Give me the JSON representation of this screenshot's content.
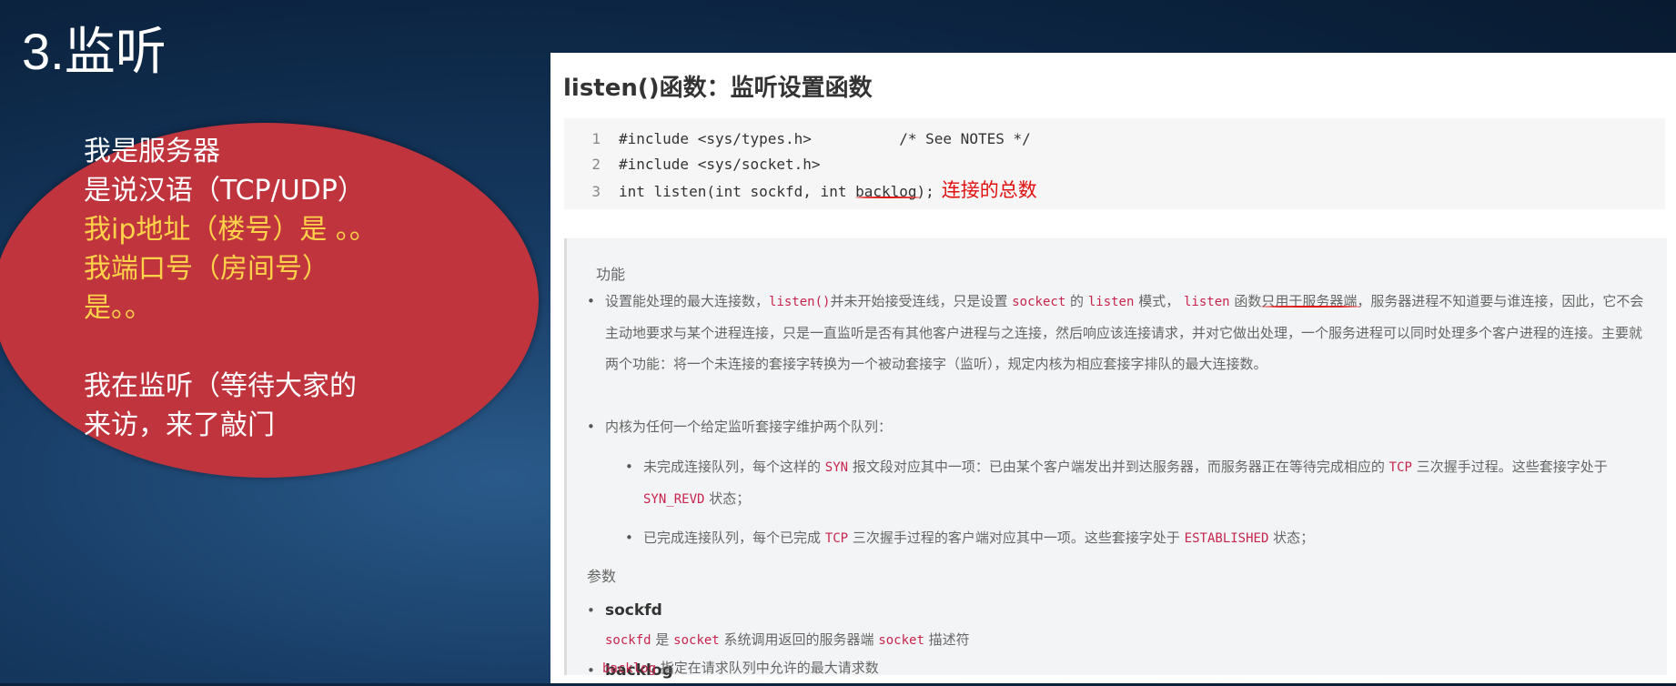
{
  "slide": {
    "title": "3.监听",
    "bubble": [
      "我是服务器",
      "是说汉语（TCP/UDP）",
      "我ip地址（楼号）是 。。",
      "我端口号（房间号）",
      "是。。",
      "",
      "我在监听（等待大家的",
      "来访，来了敲门"
    ]
  },
  "doc": {
    "title": "listen()函数：监听设置函数",
    "code": [
      {
        "n": "1",
        "text": "#include <sys/types.h>          /* See NOTES */"
      },
      {
        "n": "2",
        "text": "#include <sys/socket.h>"
      },
      {
        "n": "3",
        "pre": "int listen(int sockfd, int ",
        "u": "backlog",
        "post": ");"
      }
    ],
    "annotation": "连接的总数",
    "function_heading": "功能",
    "p1": [
      "设置能处理的最大连接数，",
      "listen()",
      "并未开始接受连线，只是设置",
      "sockect",
      "的",
      "listen",
      "模式，",
      "listen",
      "函数",
      "只用于服务器端",
      "，服务器进程不知道要与谁连接，因此，它不会主动地要求与某个进程连接，只是一直监听是否有其他客户进程与之连接，然后响应该连接请求，并对它做出处理，一个服务进程可以同时处理多个客户进程的连接。主要就两个功能：将一个未连接的套接字转换为一个被动套接字（监听），规定内核为相应套接字排队的最大连接数。"
    ],
    "p2": "内核为任何一个给定监听套接字维护两个队列：",
    "p3": [
      "未完成连接队列，每个这样的",
      "SYN",
      "报文段对应其中一项：已由某个客户端发出并到达服务器，而服务器正在等待完成相应的",
      "TCP",
      "三次握手过程。这些套接字处于",
      "SYN_REVD",
      "状态；"
    ],
    "p4": [
      "已完成连接队列，每个已完成",
      "TCP",
      "三次握手过程的客户端对应其中一项。这些套接字处于",
      "ESTABLISHED",
      "状态；"
    ],
    "params_heading": "参数",
    "params": [
      {
        "name": "sockfd",
        "d": [
          "sockfd",
          "是",
          "socket",
          "系统调用返回的服务器端",
          "socket",
          "描述符"
        ]
      },
      {
        "name": "backlog",
        "d": [
          "backlog",
          "指定在请求队列中允许的最大请求数"
        ]
      }
    ]
  }
}
